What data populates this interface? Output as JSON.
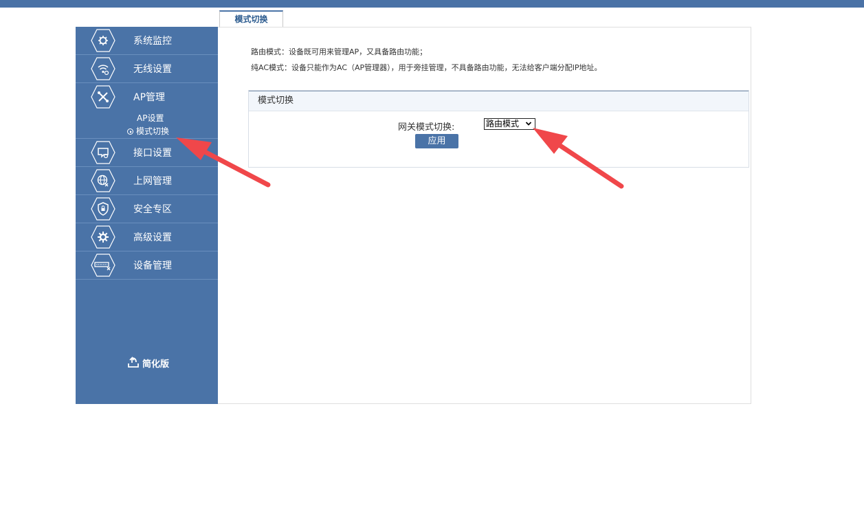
{
  "tab": {
    "label": "模式切换"
  },
  "sidebar": {
    "items": [
      {
        "label": "系统监控",
        "icon": "monitor-gear-icon"
      },
      {
        "label": "无线设置",
        "icon": "wifi-icon"
      },
      {
        "label": "AP管理",
        "icon": "ap-tools-icon",
        "sub_items": [
          {
            "label": "AP设置"
          },
          {
            "label": "模式切换",
            "active": true
          }
        ]
      },
      {
        "label": "接口设置",
        "icon": "interface-gear-icon"
      },
      {
        "label": "上网管理",
        "icon": "globe-icon"
      },
      {
        "label": "安全专区",
        "icon": "shield-lock-icon"
      },
      {
        "label": "高级设置",
        "icon": "gear-icon"
      },
      {
        "label": "设备管理",
        "icon": "device-tools-icon"
      }
    ],
    "simplify_label": "简化版"
  },
  "content": {
    "desc_line1": "路由模式：设备既可用来管理AP，又具备路由功能；",
    "desc_line2": "纯AC模式：设备只能作为AC（AP管理器），用于旁挂管理，不具备路由功能，无法给客户端分配IP地址。",
    "panel": {
      "title": "模式切换",
      "field_label": "网关模式切换:",
      "select_value": "路由模式",
      "apply_label": "应用"
    }
  },
  "colors": {
    "sidebar_bg": "#4a73a7",
    "topbar": "#4a72a6",
    "annotation_arrow": "#f0474a"
  }
}
